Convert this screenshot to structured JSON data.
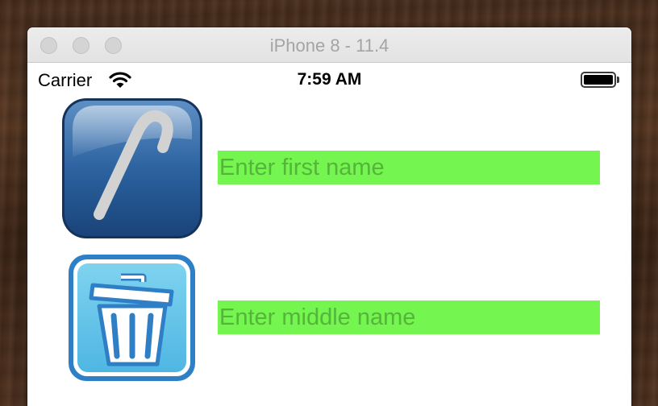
{
  "window": {
    "title": "iPhone 8 - 11.4"
  },
  "status_bar": {
    "carrier": "Carrier",
    "time": "7:59 AM",
    "wifi_icon": "wifi-icon",
    "battery_icon": "battery-icon"
  },
  "form": {
    "rows": [
      {
        "icon": "candy-cane-icon",
        "placeholder": "Enter first name",
        "value": ""
      },
      {
        "icon": "trash-can-icon",
        "placeholder": "Enter middle name",
        "value": ""
      }
    ],
    "field_color": "#74f54f",
    "placeholder_color": "#55b53a"
  }
}
